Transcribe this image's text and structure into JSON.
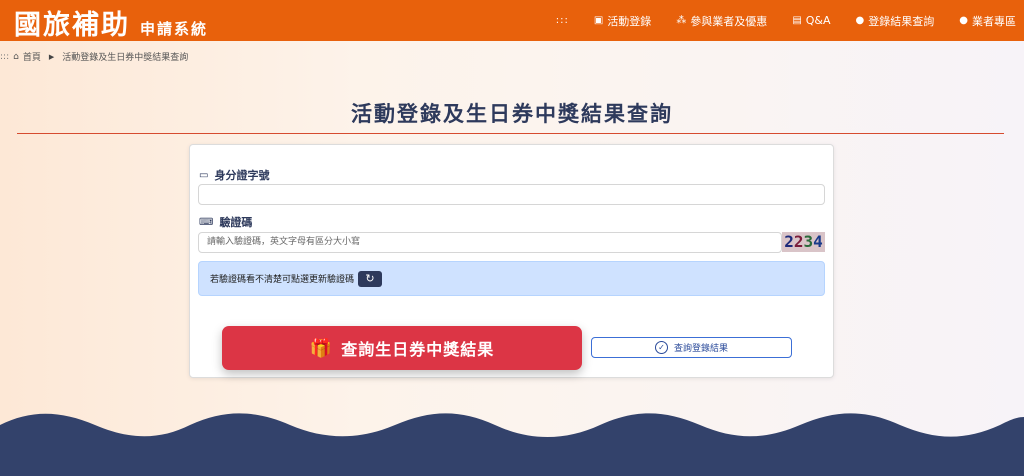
{
  "header": {
    "logo_main": "國旅補助",
    "logo_sub": "申請系統",
    "menu_dots": ":::",
    "nav": [
      {
        "label": "活動登錄",
        "icon": "register-icon"
      },
      {
        "label": "參與業者及優惠",
        "icon": "shops-icon"
      },
      {
        "label": "Q&A",
        "icon": "faq-icon"
      },
      {
        "label": "登錄結果查詢",
        "icon": "search-icon"
      },
      {
        "label": "業者專區",
        "icon": "user-icon"
      }
    ]
  },
  "breadcrumb": {
    "dots": ":::",
    "home": "首頁",
    "current": "活動登錄及生日券中獎結果查詢"
  },
  "page": {
    "title": "活動登錄及生日券中獎結果查詢"
  },
  "form": {
    "id_label": "身分證字號",
    "id_value": "",
    "captcha_label": "驗證碼",
    "captcha_placeholder": "請輸入驗證碼，英文字母有區分大小寫",
    "captcha_image_text": "2234",
    "captcha_hint": "若驗證碼看不清楚可點選更新驗證碼",
    "primary_button": "查詢生日券中獎結果",
    "secondary_button": "查詢登錄結果"
  },
  "colors": {
    "header": "#e8610c",
    "title": "#2e3a5c",
    "primary": "#dc3545",
    "alert_bg": "#cfe2ff",
    "wave": "#33426b"
  }
}
